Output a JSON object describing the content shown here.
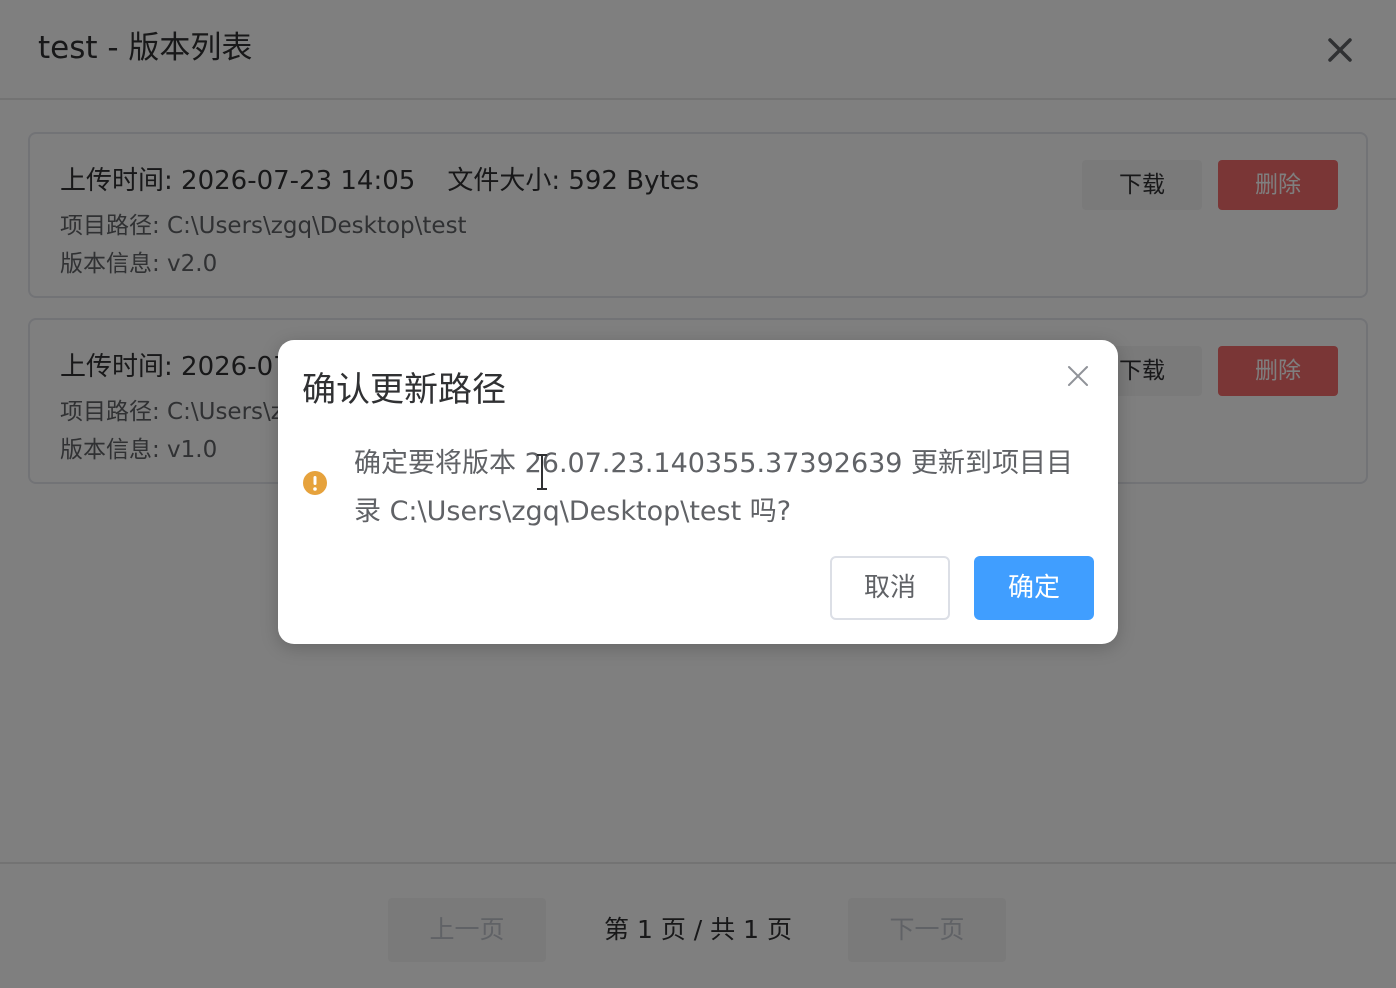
{
  "window": {
    "title": "test - 版本列表"
  },
  "versions": [
    {
      "upload_time": "上传时间: 2026-07-23 14:05",
      "file_size": "文件大小: 592 Bytes",
      "project_path": "项目路径: C:\\Users\\zgq\\Desktop\\test",
      "version_info": "版本信息: v2.0",
      "download_label": "下载",
      "delete_label": "删除"
    },
    {
      "upload_time": "上传时间: 2026-07",
      "file_size": "",
      "project_path": "项目路径: C:\\Users\\z",
      "version_info": "版本信息: v1.0",
      "download_label": "下载",
      "delete_label": "删除"
    }
  ],
  "pagination": {
    "prev_label": "上一页",
    "page_info": "第 1 页 / 共 1 页",
    "next_label": "下一页"
  },
  "dialog": {
    "title": "确认更新路径",
    "message": "确定要将版本 26.07.23.140355.37392639 更新到项目目录 C:\\Users\\zgq\\Desktop\\test 吗?",
    "cancel_label": "取消",
    "confirm_label": "确定"
  },
  "colors": {
    "primary": "#409eff",
    "danger": "#f56c6c",
    "warning": "#e6a23c"
  }
}
